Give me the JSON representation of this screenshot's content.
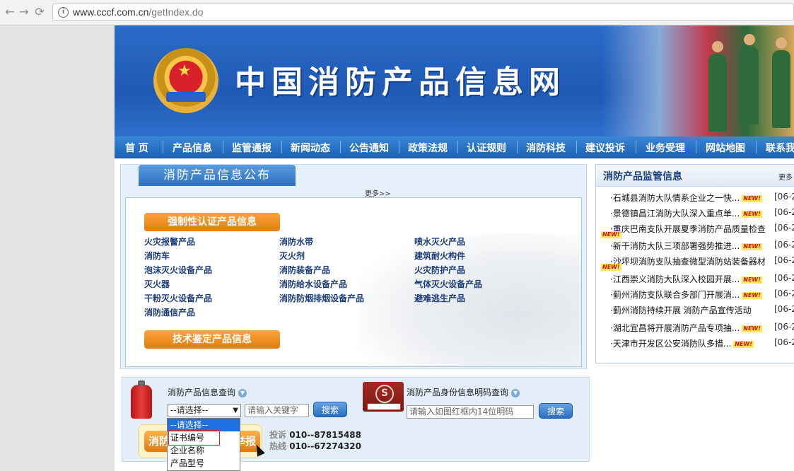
{
  "browser": {
    "url_host": "www.cccf.com.cn",
    "url_path": "/getIndex.do"
  },
  "site": {
    "title": "中国消防产品信息网"
  },
  "nav": [
    "首 页",
    "产品信息",
    "监管通报",
    "新闻动态",
    "公告通知",
    "政策法规",
    "认证规则",
    "消防科技",
    "建议投诉",
    "业务受理",
    "网站地图",
    "联系我"
  ],
  "publish": {
    "title": "消防产品信息公布",
    "more": "更多>>",
    "cert_header": "强制性认证产品信息",
    "tech_header": "技术鉴定产品信息",
    "products": [
      [
        "火灾报警产品",
        "消防水带",
        "喷水灭火产品"
      ],
      [
        "消防车",
        "灭火剂",
        "建筑耐火构件"
      ],
      [
        "泡沫灭火设备产品",
        "消防装备产品",
        "火灾防护产品"
      ],
      [
        "灭火器",
        "消防给水设备产品",
        "气体灭火设备产品"
      ],
      [
        "干粉灭火设备产品",
        "消防防烟排烟设备产品",
        "避难逃生产品"
      ],
      [
        "消防通信产品"
      ]
    ]
  },
  "supervision": {
    "title": "消防产品监管信息",
    "more": "更多",
    "new_label": "NEW!",
    "items": [
      {
        "text": "·石城县消防大队情系企业之一快...",
        "date": "[06-2",
        "new": true,
        "inline": true
      },
      {
        "text": "·景德镇昌江消防大队深入重点单...",
        "date": "[06-2",
        "new": true,
        "inline": true
      },
      {
        "text": "·重庆巴南支队开展夏季消防产品质量检查",
        "date": "[06-2",
        "new": true,
        "inline": false
      },
      {
        "text": "·新干消防大队三项部署强势推进...",
        "date": "[06-2",
        "new": true,
        "inline": true
      },
      {
        "text": "·沙坪坝消防支队抽查微型消防站装备器材",
        "date": "[06-2",
        "new": true,
        "inline": false
      },
      {
        "text": "·江西崇义消防大队深入校园开展...",
        "date": "[06-2",
        "new": true,
        "inline": true
      },
      {
        "text": "·蓟州消防支队联合多部门开展消...",
        "date": "[06-2",
        "new": true,
        "inline": true
      },
      {
        "text": "·蓟州消防持续开展 消防产品宣传活动",
        "date": "[06-2",
        "new": false,
        "inline": false
      },
      {
        "text": "·湖北宜昌将开展消防产品专项抽...",
        "date": "[06-2",
        "new": true,
        "inline": true
      },
      {
        "text": "·天津市开发区公安消防队多措...",
        "date": "[06-2",
        "new": true,
        "inline": true
      }
    ]
  },
  "search": {
    "product_label": "消防产品信息查询",
    "select_value": "--请选择--",
    "keyword_placeholder": "请输入关键字",
    "search_button": "搜索",
    "id_label": "消防产品身份信息明码查询",
    "code_placeholder": "请输入如图红框内14位明码",
    "options": [
      "--请选择--",
      "证书编号",
      "企业名称",
      "产品型号"
    ],
    "report_left": "消防",
    "report_right": "举报",
    "hotline_label1": "投诉",
    "hotline_label2": "热线",
    "hotline1": "010--87815488",
    "hotline2": "010--67274320"
  }
}
